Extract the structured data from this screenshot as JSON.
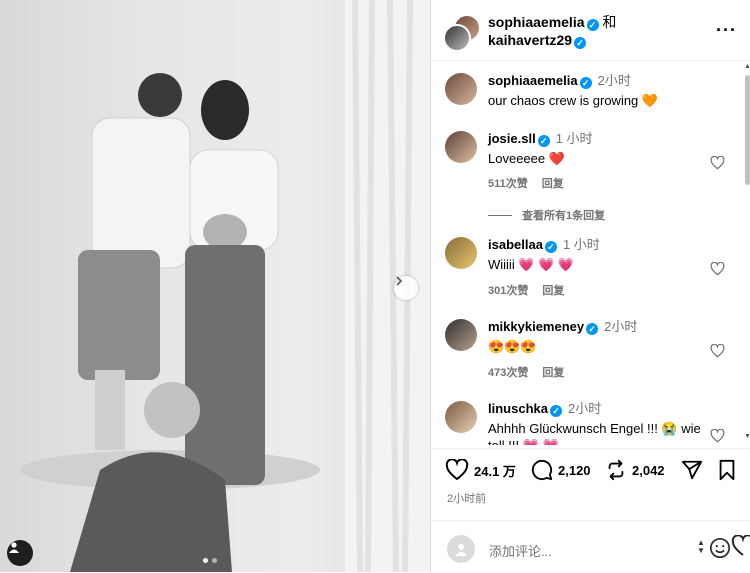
{
  "photo": {
    "dots": [
      true,
      false
    ]
  },
  "header": {
    "user1": "sophiaaemelia",
    "and": "和",
    "user2": "kaihavertz29",
    "more": "···"
  },
  "caption": {
    "user": "sophiaaemelia",
    "time": "2小时",
    "text": "our chaos crew is growing 🧡"
  },
  "comments": [
    {
      "user": "josie.sll",
      "time": "1 小时",
      "text": "Loveeeee ❤️",
      "likes": "511次赞",
      "reply": "回复"
    },
    {
      "user": "isabellaa",
      "time": "1 小时",
      "text": "Wiiiii 💗 💗 💗",
      "likes": "301次赞",
      "reply": "回复"
    },
    {
      "user": "mikkykiemeney",
      "time": "2小时",
      "text": "😍😍😍",
      "likes": "473次赞",
      "reply": "回复"
    },
    {
      "user": "linuschka",
      "time": "2小时",
      "text": "Ahhhh Glückwunsch Engel !!! 😭 wie toll !!! 💗 💗",
      "likes": "",
      "reply": ""
    }
  ],
  "view_replies": "查看所有1条回复",
  "actions": {
    "likes": "24.1 万",
    "comments": "2,120",
    "reposts": "2,042"
  },
  "post_time": "2小时前",
  "composer": {
    "placeholder": "添加评论..."
  },
  "colors": {
    "verified": "#0095f6",
    "muted": "#737373",
    "border": "#dbdbdb"
  }
}
